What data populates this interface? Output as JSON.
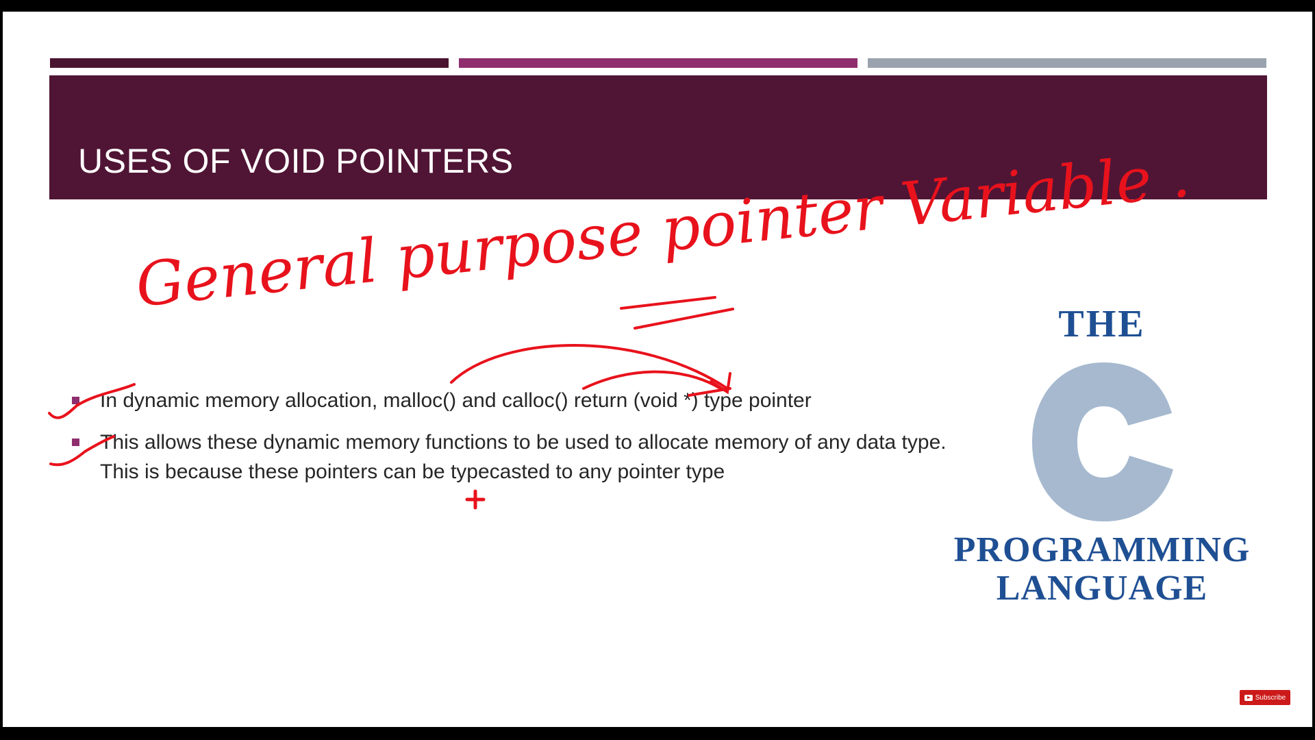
{
  "slide": {
    "title": "USES OF  VOID POINTERS",
    "bullets": [
      "In dynamic memory allocation, malloc() and calloc() return (void *) type pointer",
      "This allows these dynamic memory functions to be used to allocate memory of any data type. This is because these pointers can be typecasted to any pointer type"
    ],
    "accent_colors": [
      "#4a1530",
      "#8e2e6e",
      "#9aa3ad"
    ],
    "title_band_color": "#501535",
    "bullet_color": "#8e2e6e"
  },
  "logo": {
    "line1": "THE",
    "letter": "C",
    "line2": "PROGRAMMING",
    "line3": "LANGUAGE",
    "text_color": "#1f4f93",
    "letter_color": "#a6b9cf"
  },
  "annotation": {
    "handwritten_text": "General purpose pointer Variable .",
    "ink_color": "#e8121c"
  },
  "player": {
    "subscribe_label": "Subscribe"
  }
}
